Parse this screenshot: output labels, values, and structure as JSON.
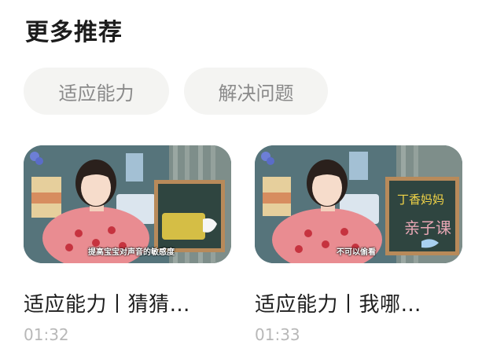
{
  "section": {
    "title": "更多推荐"
  },
  "tags": [
    "适应能力",
    "解决问题"
  ],
  "videos": [
    {
      "title": "适应能力丨猜猜…",
      "duration": "01:32",
      "caption": "提高宝宝对声音的敏感度"
    },
    {
      "title": "适应能力丨我哪…",
      "duration": "01:33",
      "caption": "不可以偷看"
    }
  ]
}
